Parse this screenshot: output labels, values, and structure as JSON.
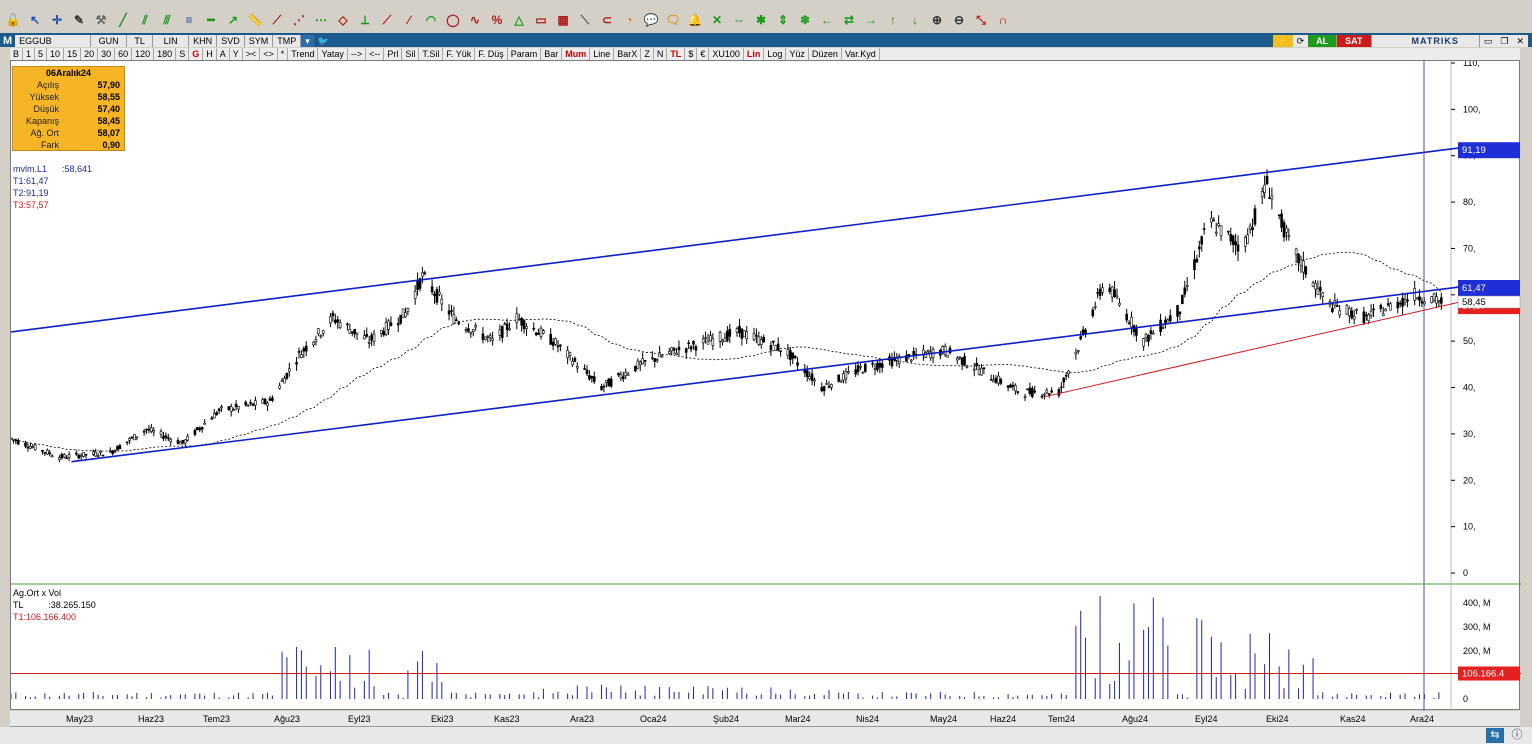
{
  "toolbar": {
    "icons": [
      "lock-open-icon",
      "cursor-arrow-icon",
      "crosshair-icon",
      "pencil-icon",
      "tools-icon",
      "green-line-icon",
      "parallel-lines-icon",
      "channel-icon",
      "equal-lines-icon",
      "horizontal-line-icon",
      "arrow-line-icon",
      "ruler-icon",
      "fibonacci-fan-icon",
      "fibonacci-icon",
      "fibonacci-ret-icon",
      "gann-icon",
      "andrews-icon",
      "speed-lines-icon",
      "regression-icon",
      "fibonacci-arc-icon",
      "cycle-icon",
      "elliott-icon",
      "percent-icon",
      "triangle-icon",
      "box-icon",
      "grid-icon",
      "diagonal-icon",
      "magnet-icon",
      "pie-icon",
      "speech-icon",
      "chat-icon",
      "bell-icon",
      "zoom-x-icon",
      "zoom-fit-icon",
      "zoom-y-icon",
      "zoom-vertical-icon",
      "snowflake-icon",
      "arrow-left-icon",
      "arrow-right-left-icon",
      "arrow-right-icon",
      "arrow-up-icon",
      "arrow-down-icon",
      "zoom-in-icon",
      "zoom-out-icon",
      "shrink-icon",
      "magnet-red-icon"
    ]
  },
  "row2": {
    "m_label": "M",
    "symbol": "EGGUB",
    "period": "GUN",
    "currency": "TL",
    "scale": "LIN",
    "cells": [
      "KHN",
      "SVD",
      "SYM",
      "TMP"
    ],
    "al_label": "AL",
    "sat_label": "SAT",
    "brand": "MATRIKS"
  },
  "row3": {
    "cells": [
      "B",
      "1",
      "5",
      "10",
      "15",
      "20",
      "30",
      "60",
      "120",
      "180",
      "S",
      "G",
      "H",
      "A",
      "Y",
      "><",
      "<>",
      "*",
      "Trend",
      "Yatay",
      "-->",
      "<--",
      "Prl",
      "Sil",
      "T.Sil",
      "F. Yük",
      "F. Düş",
      "Param",
      "Bar",
      "Mum",
      "Line",
      "BarX",
      "Z",
      "N",
      "TL",
      "$",
      "€",
      "XU100",
      "Lin",
      "Log",
      "Yüz",
      "Düzen",
      "Var.Kyd"
    ],
    "red_cells": [
      "G",
      "Mum",
      "TL",
      "Lin"
    ]
  },
  "info": {
    "date": "06Aralık24",
    "rows": [
      {
        "k": "Açılış",
        "v": "57,90"
      },
      {
        "k": "Yüksek",
        "v": "58,55"
      },
      {
        "k": "Düşük",
        "v": "57,40"
      },
      {
        "k": "Kapanış",
        "v": "58,45"
      },
      {
        "k": "Ağ. Ort",
        "v": "58,07"
      },
      {
        "k": "Fark",
        "v": "0,90"
      }
    ]
  },
  "legend": {
    "mvlm": "mvlm.L1",
    "mvlm_val": ":58,641",
    "t1": "T1:61,47",
    "t2": "T2:91,19",
    "t3": "T3:57,57"
  },
  "vol_legend": {
    "title": "Ag.Ort x Vol",
    "tl": "TL",
    "tl_val": ":38.265.150",
    "t1": "T1:106.166.400"
  },
  "price_axis": [
    "110,",
    "100,",
    "90,",
    "80,",
    "70,",
    "60,",
    "50,",
    "40,",
    "30,",
    "20,",
    "10,",
    "0"
  ],
  "price_tags": {
    "blue_top": "91,19",
    "blue_mid": "61,47",
    "last": "58,45",
    "red": "57,57"
  },
  "vol_axis": [
    "400, M",
    "300, M",
    "200, M",
    "100, M",
    "0"
  ],
  "vol_tag": "106.166.4",
  "dates": [
    "May23",
    "Haz23",
    "Tem23",
    "Ağu23",
    "Eyl23",
    "Eki23",
    "Kas23",
    "Ara23",
    "Oca24",
    "Şub24",
    "Mar24",
    "Nis24",
    "May24",
    "Haz24",
    "Tem24",
    "Ağu24",
    "Eyl24",
    "Eki24",
    "Kas24",
    "Ara24"
  ],
  "colors": {
    "up": "#000000",
    "down": "#000000",
    "channel": "#0b1fc6",
    "trend": "#d01818",
    "volume": "#2222aa",
    "ma": "#000000",
    "cursor": "#6b3fa0"
  },
  "chart_data": {
    "type": "candlestick",
    "symbol": "EGGUB",
    "ylim": [
      0,
      110
    ],
    "vol_ylim": [
      0,
      450
    ],
    "price_path": [
      [
        "2023-04-25",
        29
      ],
      [
        "2023-05-15",
        25
      ],
      [
        "2023-06-05",
        26
      ],
      [
        "2023-06-20",
        31
      ],
      [
        "2023-07-05",
        28
      ],
      [
        "2023-07-20",
        35
      ],
      [
        "2023-08-10",
        37
      ],
      [
        "2023-08-22",
        47
      ],
      [
        "2023-09-05",
        55
      ],
      [
        "2023-09-20",
        50
      ],
      [
        "2023-10-05",
        56
      ],
      [
        "2023-10-12",
        64
      ],
      [
        "2023-10-25",
        55
      ],
      [
        "2023-11-10",
        50
      ],
      [
        "2023-11-20",
        55
      ],
      [
        "2023-12-05",
        50
      ],
      [
        "2023-12-25",
        40
      ],
      [
        "2024-01-10",
        45
      ],
      [
        "2024-01-25",
        48
      ],
      [
        "2024-02-20",
        52
      ],
      [
        "2024-03-10",
        48
      ],
      [
        "2024-03-25",
        40
      ],
      [
        "2024-04-10",
        44
      ],
      [
        "2024-04-25",
        46
      ],
      [
        "2024-05-15",
        48
      ],
      [
        "2024-06-01",
        43
      ],
      [
        "2024-06-15",
        39
      ],
      [
        "2024-07-01",
        39
      ],
      [
        "2024-07-10",
        50
      ],
      [
        "2024-07-20",
        63
      ],
      [
        "2024-08-05",
        50
      ],
      [
        "2024-08-20",
        57
      ],
      [
        "2024-09-01",
        76
      ],
      [
        "2024-09-15",
        70
      ],
      [
        "2024-09-25",
        84
      ],
      [
        "2024-10-05",
        70
      ],
      [
        "2024-10-20",
        58
      ],
      [
        "2024-11-05",
        55
      ],
      [
        "2024-11-25",
        60
      ],
      [
        "2024-12-06",
        58.45
      ]
    ],
    "volume_peaks_M": [
      [
        "2023-08-22",
        230
      ],
      [
        "2023-09-15",
        270
      ],
      [
        "2023-10-12",
        290
      ],
      [
        "2024-07-15",
        450
      ],
      [
        "2024-07-25",
        440
      ],
      [
        "2024-08-05",
        400
      ],
      [
        "2024-09-25",
        440
      ],
      [
        "2024-10-10",
        170
      ],
      [
        "2024-12-06",
        38.27
      ]
    ],
    "channel_upper": [
      [
        "2023-04-25",
        52
      ],
      [
        "2024-12-10",
        92
      ]
    ],
    "channel_lower": [
      [
        "2023-05-20",
        24
      ],
      [
        "2024-12-10",
        62
      ]
    ],
    "trend_support": [
      [
        "2024-06-25",
        38
      ],
      [
        "2024-12-10",
        59
      ]
    ]
  }
}
